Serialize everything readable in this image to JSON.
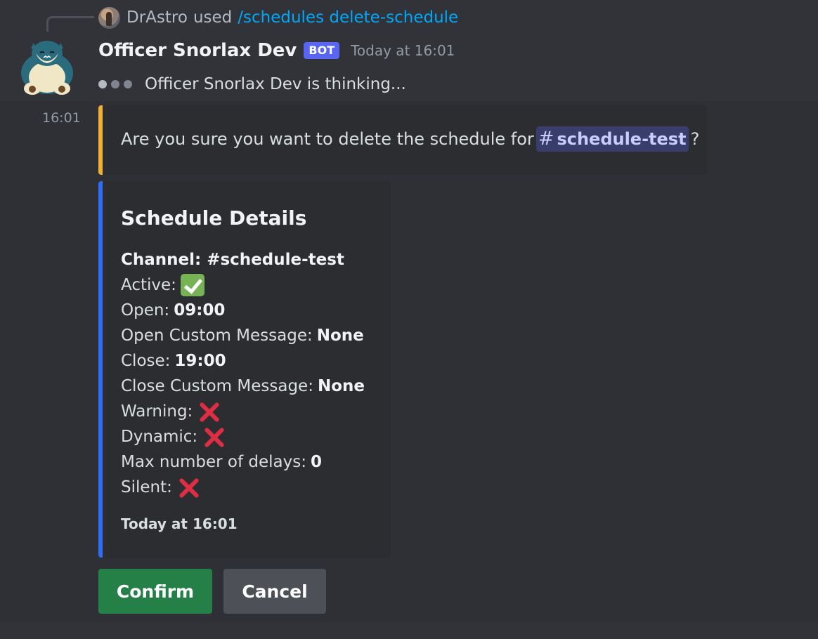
{
  "reply": {
    "username": "DrAstro",
    "used_text": "used",
    "command": "/schedules delete-schedule"
  },
  "message": {
    "author": "Officer Snorlax Dev",
    "bot_tag": "BOT",
    "timestamp": "Today at 16:01",
    "thinking_text": "Officer Snorlax Dev is thinking...",
    "side_time": "16:01"
  },
  "confirm_embed": {
    "text_before": "Are you sure you want to delete the schedule for",
    "channel_hash": "#",
    "channel_name": "schedule-test",
    "text_after": "?",
    "accent_color": "#f0b132"
  },
  "details_embed": {
    "title": "Schedule Details",
    "accent_color": "#2f6df5",
    "channel_line": "Channel: #schedule-test",
    "active_label": "Active:",
    "active_icon": "check-mark-icon",
    "open_label": "Open:",
    "open_value": "09:00",
    "open_custom_label": "Open Custom Message:",
    "open_custom_value": "None",
    "close_label": "Close:",
    "close_value": "19:00",
    "close_custom_label": "Close Custom Message:",
    "close_custom_value": "None",
    "warning_label": "Warning:",
    "warning_icon": "cross-mark-icon",
    "dynamic_label": "Dynamic:",
    "dynamic_icon": "cross-mark-icon",
    "max_delays_label": "Max number of delays:",
    "max_delays_value": "0",
    "silent_label": "Silent:",
    "silent_icon": "cross-mark-icon",
    "footer": "Today at 16:01"
  },
  "buttons": {
    "confirm_label": "Confirm",
    "cancel_label": "Cancel",
    "confirm_color": "#248046",
    "cancel_color": "#4e5058"
  }
}
